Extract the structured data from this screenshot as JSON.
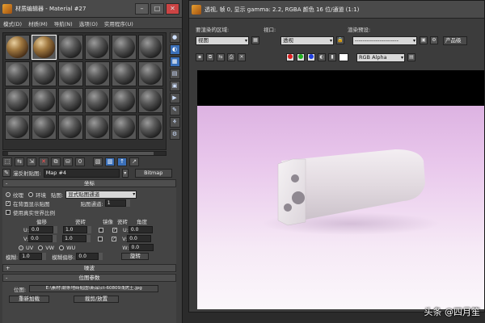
{
  "material_editor": {
    "title": "材质编辑器 - Material #27",
    "menu": [
      "模式(D)",
      "材质(M)",
      "导航(N)",
      "选项(O)",
      "实用程序(U)"
    ],
    "name_label": "漫反射贴图:",
    "map_name": "Map #4",
    "map_type": "Bitmap",
    "params": {
      "coords_header": "坐标",
      "texture": "纹理",
      "environ": "环境",
      "mapping_label": "贴图:",
      "mapping_value": "显式贴图通道",
      "show_map_on_back": "在背面显示贴图",
      "map_channel_label": "贴图通道:",
      "map_channel_value": "1",
      "use_real_world": "使用真实世界比例",
      "offset": "偏移",
      "tiling": "瓷砖",
      "mirror": "镜像",
      "tile": "瓷砖",
      "angle": "角度",
      "u_label": "U:",
      "v_label": "V:",
      "w_label": "W:",
      "u_offset": "0.0",
      "v_offset": "0.0",
      "u_tiling": "1.0",
      "v_tiling": "1.0",
      "u_angle": "0.0",
      "v_angle": "0.0",
      "w_angle": "0.0",
      "uv": "UV",
      "vw": "VW",
      "wu": "WU",
      "blur_label": "模糊:",
      "blur_value": "1.0",
      "blur_offset_label": "模糊偏移:",
      "blur_offset_value": "0.0",
      "rotate_btn": "旋转",
      "noise_header": "噪波",
      "bitmap_params_header": "位图参数",
      "bitmap_label": "位图:",
      "bitmap_path": "E:\\素材\\朝条地砖贴图\\新品\\ct-60809浅虎王.jpg",
      "reload_btn": "重新加载",
      "crop_btn": "裁剪/放置"
    }
  },
  "viewport": {
    "title": "透视, 帧 0, 显示 gamma: 2.2, RGBA 颜色 16 位/通道 (1:1)",
    "area_label": "要渲染的区域:",
    "area_value": "视图",
    "viewport_label": "视口:",
    "viewport_value": "透视",
    "preset_label": "渲染预设:",
    "preset_value": "-----------------------",
    "product_btn": "产品级",
    "channel_value": "RGB Alpha"
  },
  "watermark": "头条 @四月笙",
  "colors": {
    "accent": "#3a6fb8",
    "render_bg_top": "#d6a6dc",
    "render_bg_bottom": "#fbf7fb",
    "object": "#e4dde2"
  }
}
